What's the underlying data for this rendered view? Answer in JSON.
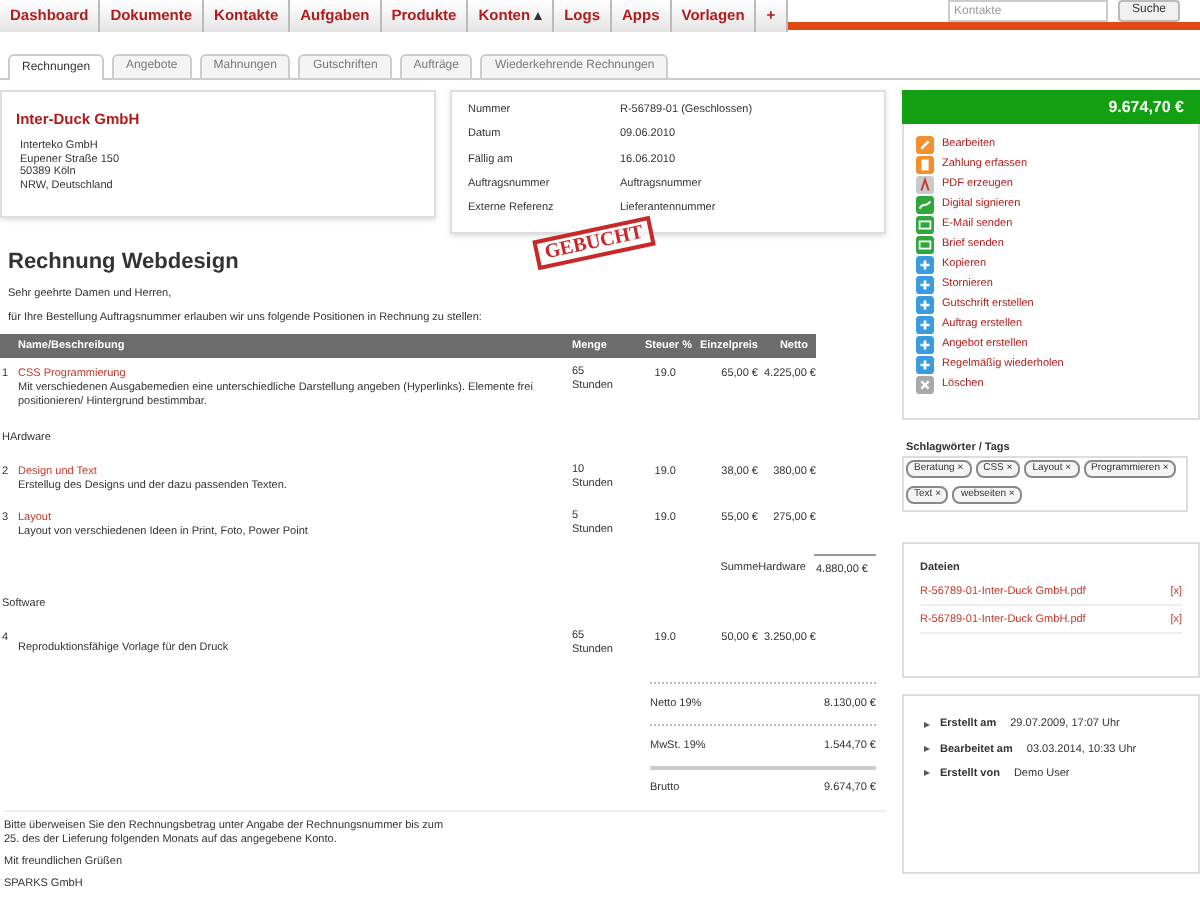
{
  "nav": {
    "items": [
      {
        "label": "Dashboard",
        "dropdown": false
      },
      {
        "label": "Dokumente",
        "dropdown": false
      },
      {
        "label": "Kontakte",
        "dropdown": false
      },
      {
        "label": "Aufgaben",
        "dropdown": false
      },
      {
        "label": "Produkte",
        "dropdown": false
      },
      {
        "label": "Konten",
        "dropdown": true
      },
      {
        "label": "Logs",
        "dropdown": false
      },
      {
        "label": "Apps",
        "dropdown": false
      },
      {
        "label": "Vorlagen",
        "dropdown": false
      },
      {
        "label": "+",
        "dropdown": false
      }
    ],
    "search": {
      "placeholder": "Kontakte",
      "button": "Suche"
    }
  },
  "tabs": [
    {
      "label": "Rechnungen",
      "selected": true
    },
    {
      "label": "Angebote",
      "selected": false
    },
    {
      "label": "Mahnungen",
      "selected": false
    },
    {
      "label": "Gutschriften",
      "selected": false
    },
    {
      "label": "Aufträge",
      "selected": false
    },
    {
      "label": "Wiederkehrende Rechnungen",
      "selected": false
    }
  ],
  "address": {
    "company": "Inter-Duck GmbH",
    "lines": [
      "Interteko GmbH",
      "Eupener Straße 150",
      "50389 Köln",
      "NRW, Deutschland"
    ]
  },
  "meta": [
    {
      "label": "Nummer",
      "value": "R-56789-01 (Geschlossen)"
    },
    {
      "label": "Datum",
      "value": "09.06.2010"
    },
    {
      "label": "Fällig am",
      "value": "16.06.2010"
    },
    {
      "label": "Auftragsnummer",
      "value": "Auftragsnummer"
    },
    {
      "label": "Externe Referenz",
      "value": "Lieferantennummer"
    }
  ],
  "stamp": "GEBUCHT",
  "title": "Rechnung Webdesign",
  "greeting": "Sehr geehrte Damen und Herren,",
  "intro": "für Ihre Bestellung Auftragsnummer erlauben wir uns folgende Positionen in Rechnung zu stellen:",
  "table": {
    "columns": [
      "Name/Beschreibung",
      "Menge",
      "Steuer %",
      "Einzelpreis",
      "Netto"
    ],
    "rows": [
      {
        "kind": "position",
        "no": "1",
        "name": "CSS Programmierung",
        "description": "Mit verschiedenen Ausgabemedien eine unterschiedliche Darstellung angeben (Hyperlinks). Elemente frei positionieren/ Hintergrund bestimmbar.",
        "quantity": "65 Stunden",
        "tax": "19.0",
        "price": "65,00 €",
        "net": "4.225,00 €"
      },
      {
        "kind": "group",
        "label": "HArdware"
      },
      {
        "kind": "position",
        "no": "2",
        "name": "Design und Text",
        "description": "Erstellug des Designs und der dazu passenden Texten.",
        "quantity": "10 Stunden",
        "tax": "19.0",
        "price": "38,00 €",
        "net": "380,00 €"
      },
      {
        "kind": "position",
        "no": "3",
        "name": "Layout",
        "description": "Layout von verschiedenen Ideen in Print, Foto, Power Point",
        "quantity": "5 Stunden",
        "tax": "19.0",
        "price": "55,00 €",
        "net": "275,00 €"
      },
      {
        "kind": "subtotal",
        "subtotal_label": "SummeHardware",
        "net": "4.880,00 €"
      },
      {
        "kind": "group",
        "label": "Software"
      },
      {
        "kind": "position",
        "no": "4",
        "description": "Reproduktionsfähige Vorlage für den Druck",
        "quantity": "65 Stunden",
        "tax": "19.0",
        "price": "50,00 €",
        "net": "3.250,00 €"
      }
    ]
  },
  "totals": [
    {
      "label": "Netto 19%",
      "value": "8.130,00 €"
    },
    {
      "label": "MwSt. 19%",
      "value": "1.544,70 €"
    },
    {
      "label": "Brutto",
      "value": "9.674,70 €"
    }
  ],
  "footer": [
    "Bitte überweisen Sie den Rechnungsbetrag unter Angabe der Rechnungsnummer bis zum 25. des der Lieferung folgenden Monats auf das angegebene Konto.",
    "Mit freundlichen Grüßen",
    "SPARKS GmbH"
  ],
  "sidebar": {
    "total": "9.674,70 €",
    "actions": [
      {
        "label": "Bearbeiten",
        "kind": "edit"
      },
      {
        "label": "Zahlung erfassen",
        "kind": "payment"
      },
      {
        "label": "PDF erzeugen",
        "kind": "pdf"
      },
      {
        "label": "Digital signieren",
        "kind": "sign"
      },
      {
        "label": "E-Mail senden",
        "kind": "mail"
      },
      {
        "label": "Brief senden",
        "kind": "mail"
      },
      {
        "label": "Kopieren",
        "kind": "add"
      },
      {
        "label": "Stornieren",
        "kind": "add"
      },
      {
        "label": "Gutschrift erstellen",
        "kind": "add"
      },
      {
        "label": "Auftrag erstellen",
        "kind": "add"
      },
      {
        "label": "Angebot erstellen",
        "kind": "add"
      },
      {
        "label": "Regelmäßig wiederholen",
        "kind": "add"
      },
      {
        "label": "Löschen",
        "kind": "delete"
      }
    ],
    "tags_title": "Schlagwörter / Tags",
    "tags": [
      {
        "label": "Beratung",
        "remove": "×"
      },
      {
        "label": "CSS",
        "remove": "×"
      },
      {
        "label": "Layout",
        "remove": "×"
      },
      {
        "label": "Programmieren",
        "remove": "×"
      },
      {
        "label": "Text",
        "remove": "×"
      },
      {
        "label": "webseiten",
        "remove": "×"
      }
    ],
    "files_title": "Dateien",
    "files": [
      {
        "name": "R-56789-01-Inter-Duck GmbH.pdf",
        "remove": "[x]"
      },
      {
        "name": "R-56789-01-Inter-Duck GmbH.pdf",
        "remove": "[x]"
      }
    ],
    "history": [
      {
        "label": "Erstellt am",
        "value": "29.07.2009, 17:07 Uhr"
      },
      {
        "label": "Bearbeitet am",
        "value": "03.03.2014, 10:33 Uhr"
      },
      {
        "label": "Erstellt von",
        "value": "Demo User"
      }
    ]
  }
}
